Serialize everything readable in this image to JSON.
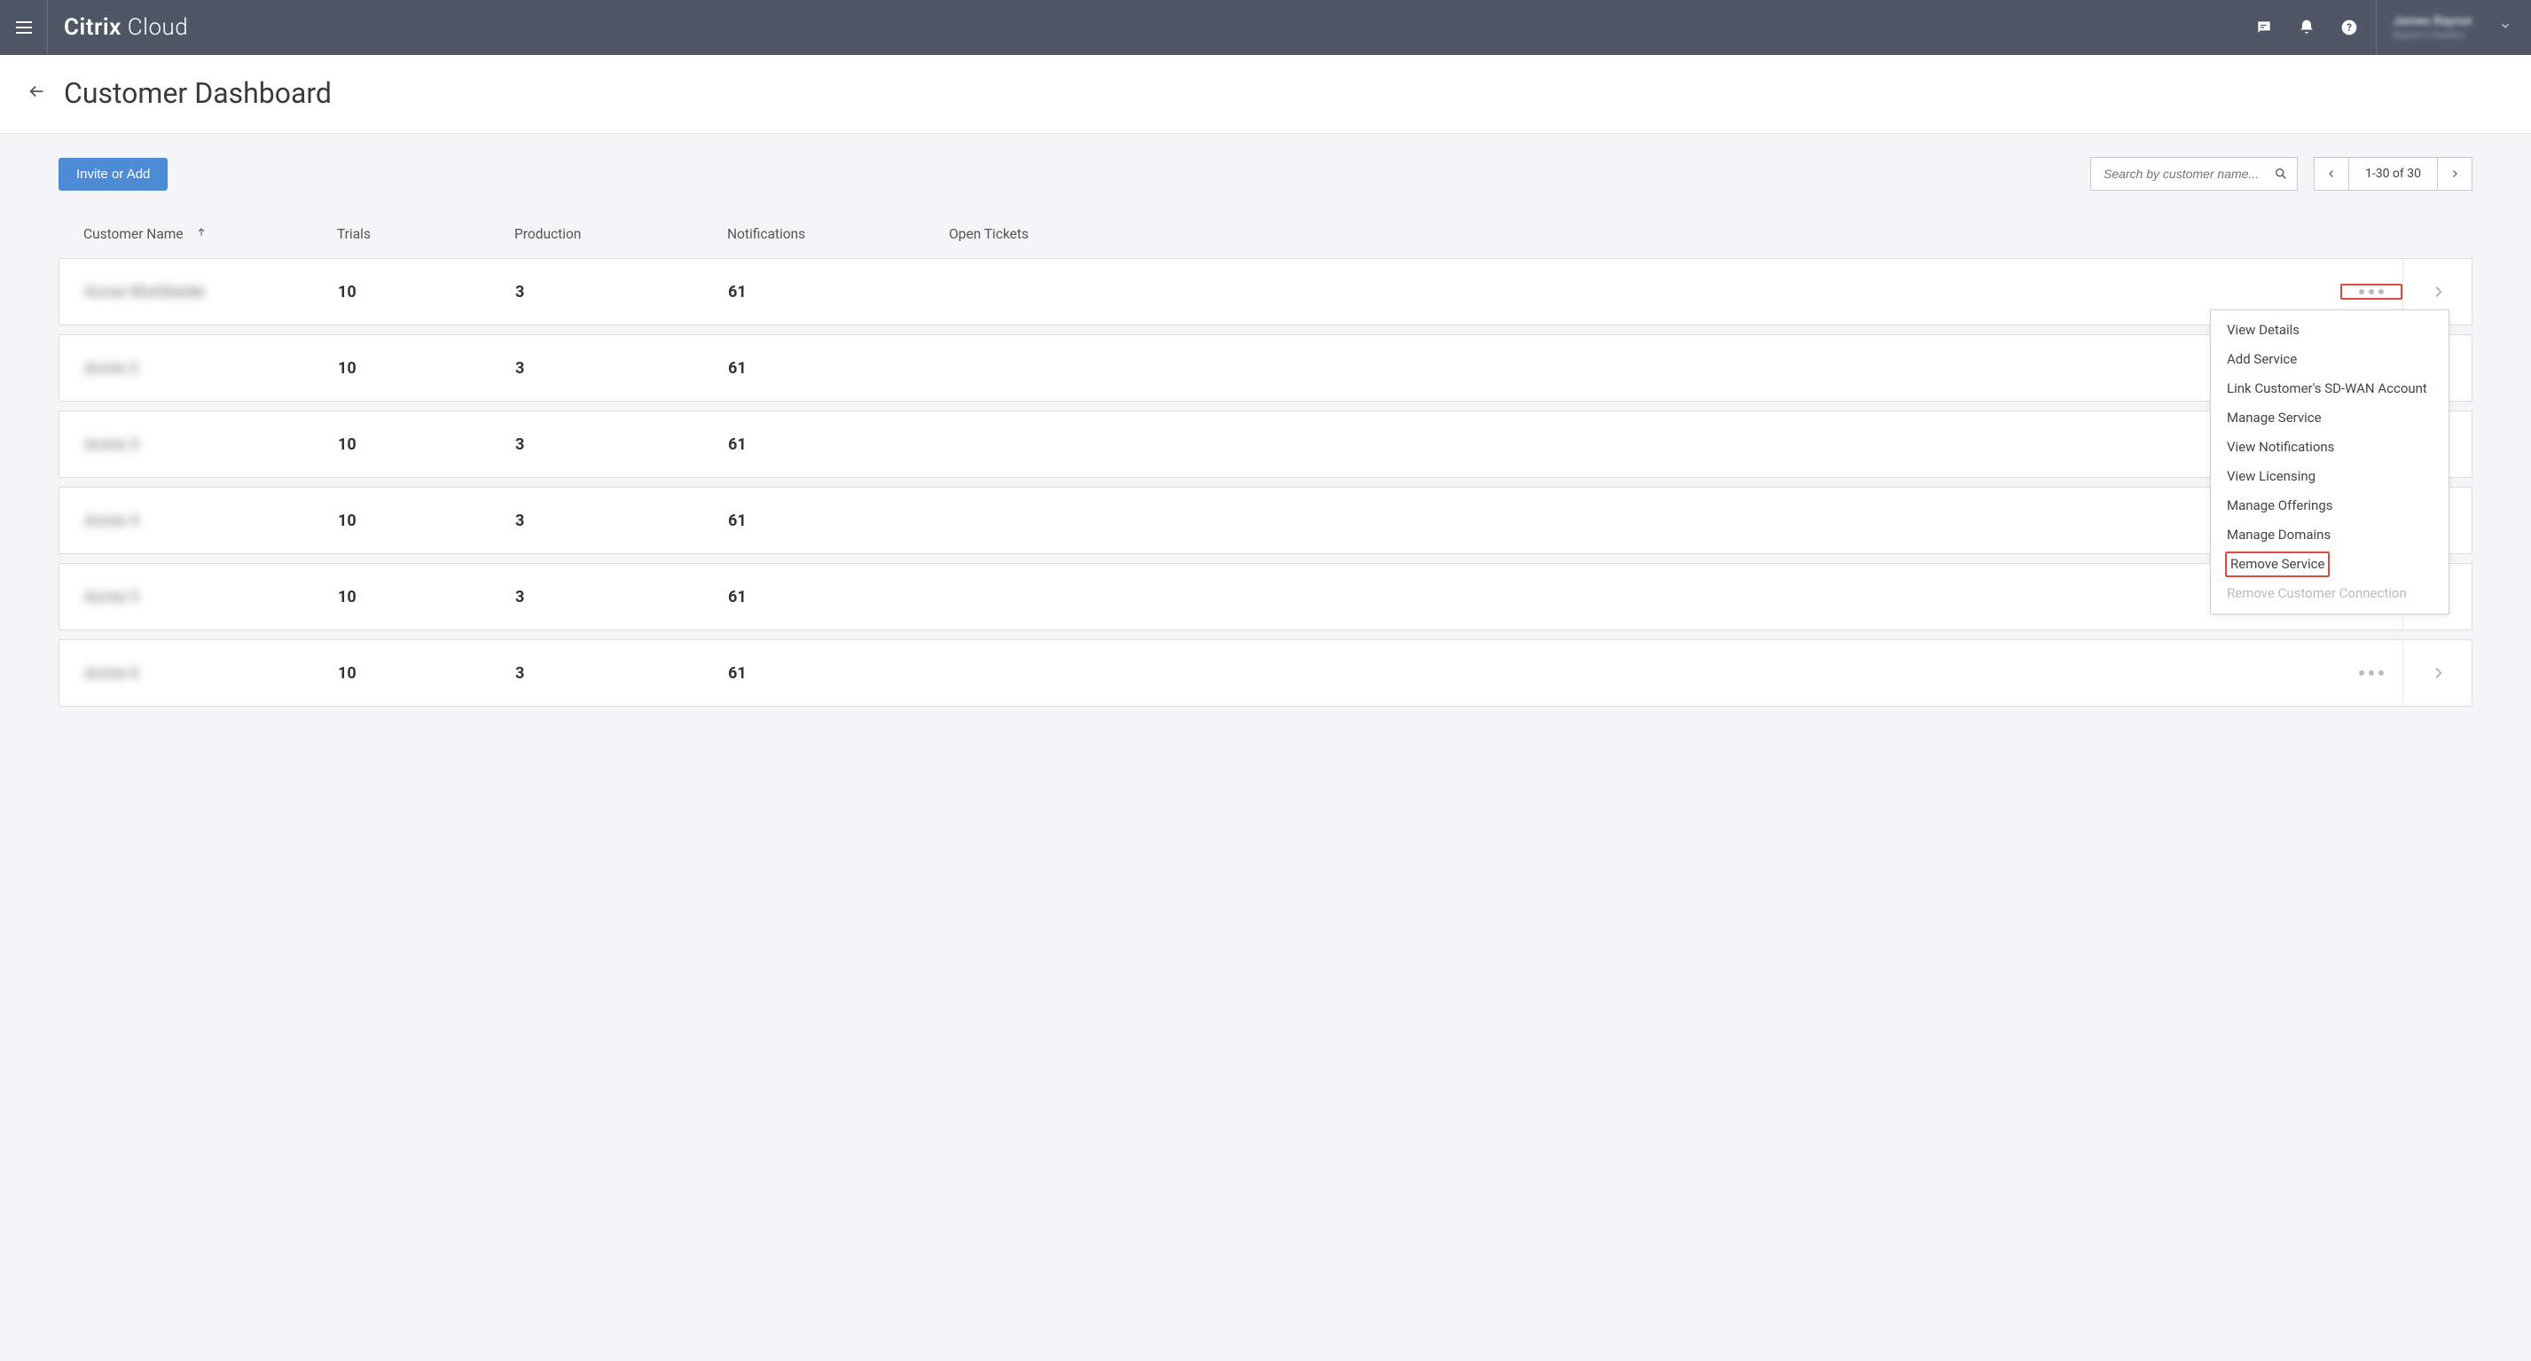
{
  "header": {
    "brand_main": "Citrix",
    "brand_sub": "Cloud",
    "user_name": "James Raynor",
    "user_sub": "Raynor's Raiders"
  },
  "page": {
    "title": "Customer Dashboard"
  },
  "toolbar": {
    "invite_label": "Invite or Add",
    "search_placeholder": "Search by customer name...",
    "pager_label": "1-30 of 30"
  },
  "columns": {
    "name": "Customer Name",
    "trials": "Trials",
    "production": "Production",
    "notifications": "Notifications",
    "tickets": "Open Tickets"
  },
  "rows": [
    {
      "name": "Acme Worldwide",
      "trials": "10",
      "production": "3",
      "notifications": "61",
      "tickets": ""
    },
    {
      "name": "Acme 2",
      "trials": "10",
      "production": "3",
      "notifications": "61",
      "tickets": ""
    },
    {
      "name": "Acme 3",
      "trials": "10",
      "production": "3",
      "notifications": "61",
      "tickets": ""
    },
    {
      "name": "Acme 4",
      "trials": "10",
      "production": "3",
      "notifications": "61",
      "tickets": ""
    },
    {
      "name": "Acme 5",
      "trials": "10",
      "production": "3",
      "notifications": "61",
      "tickets": ""
    },
    {
      "name": "Acme 6",
      "trials": "10",
      "production": "3",
      "notifications": "61",
      "tickets": ""
    }
  ],
  "menu": {
    "items": [
      {
        "label": "View Details",
        "disabled": false,
        "highlight": false
      },
      {
        "label": "Add Service",
        "disabled": false,
        "highlight": false
      },
      {
        "label": "Link Customer's SD-WAN Account",
        "disabled": false,
        "highlight": false
      },
      {
        "label": "Manage Service",
        "disabled": false,
        "highlight": false
      },
      {
        "label": "View Notifications",
        "disabled": false,
        "highlight": false
      },
      {
        "label": "View Licensing",
        "disabled": false,
        "highlight": false
      },
      {
        "label": "Manage Offerings",
        "disabled": false,
        "highlight": false
      },
      {
        "label": "Manage Domains",
        "disabled": false,
        "highlight": false
      },
      {
        "label": "Remove Service",
        "disabled": false,
        "highlight": true
      },
      {
        "label": "Remove Customer Connection",
        "disabled": true,
        "highlight": false
      }
    ]
  }
}
